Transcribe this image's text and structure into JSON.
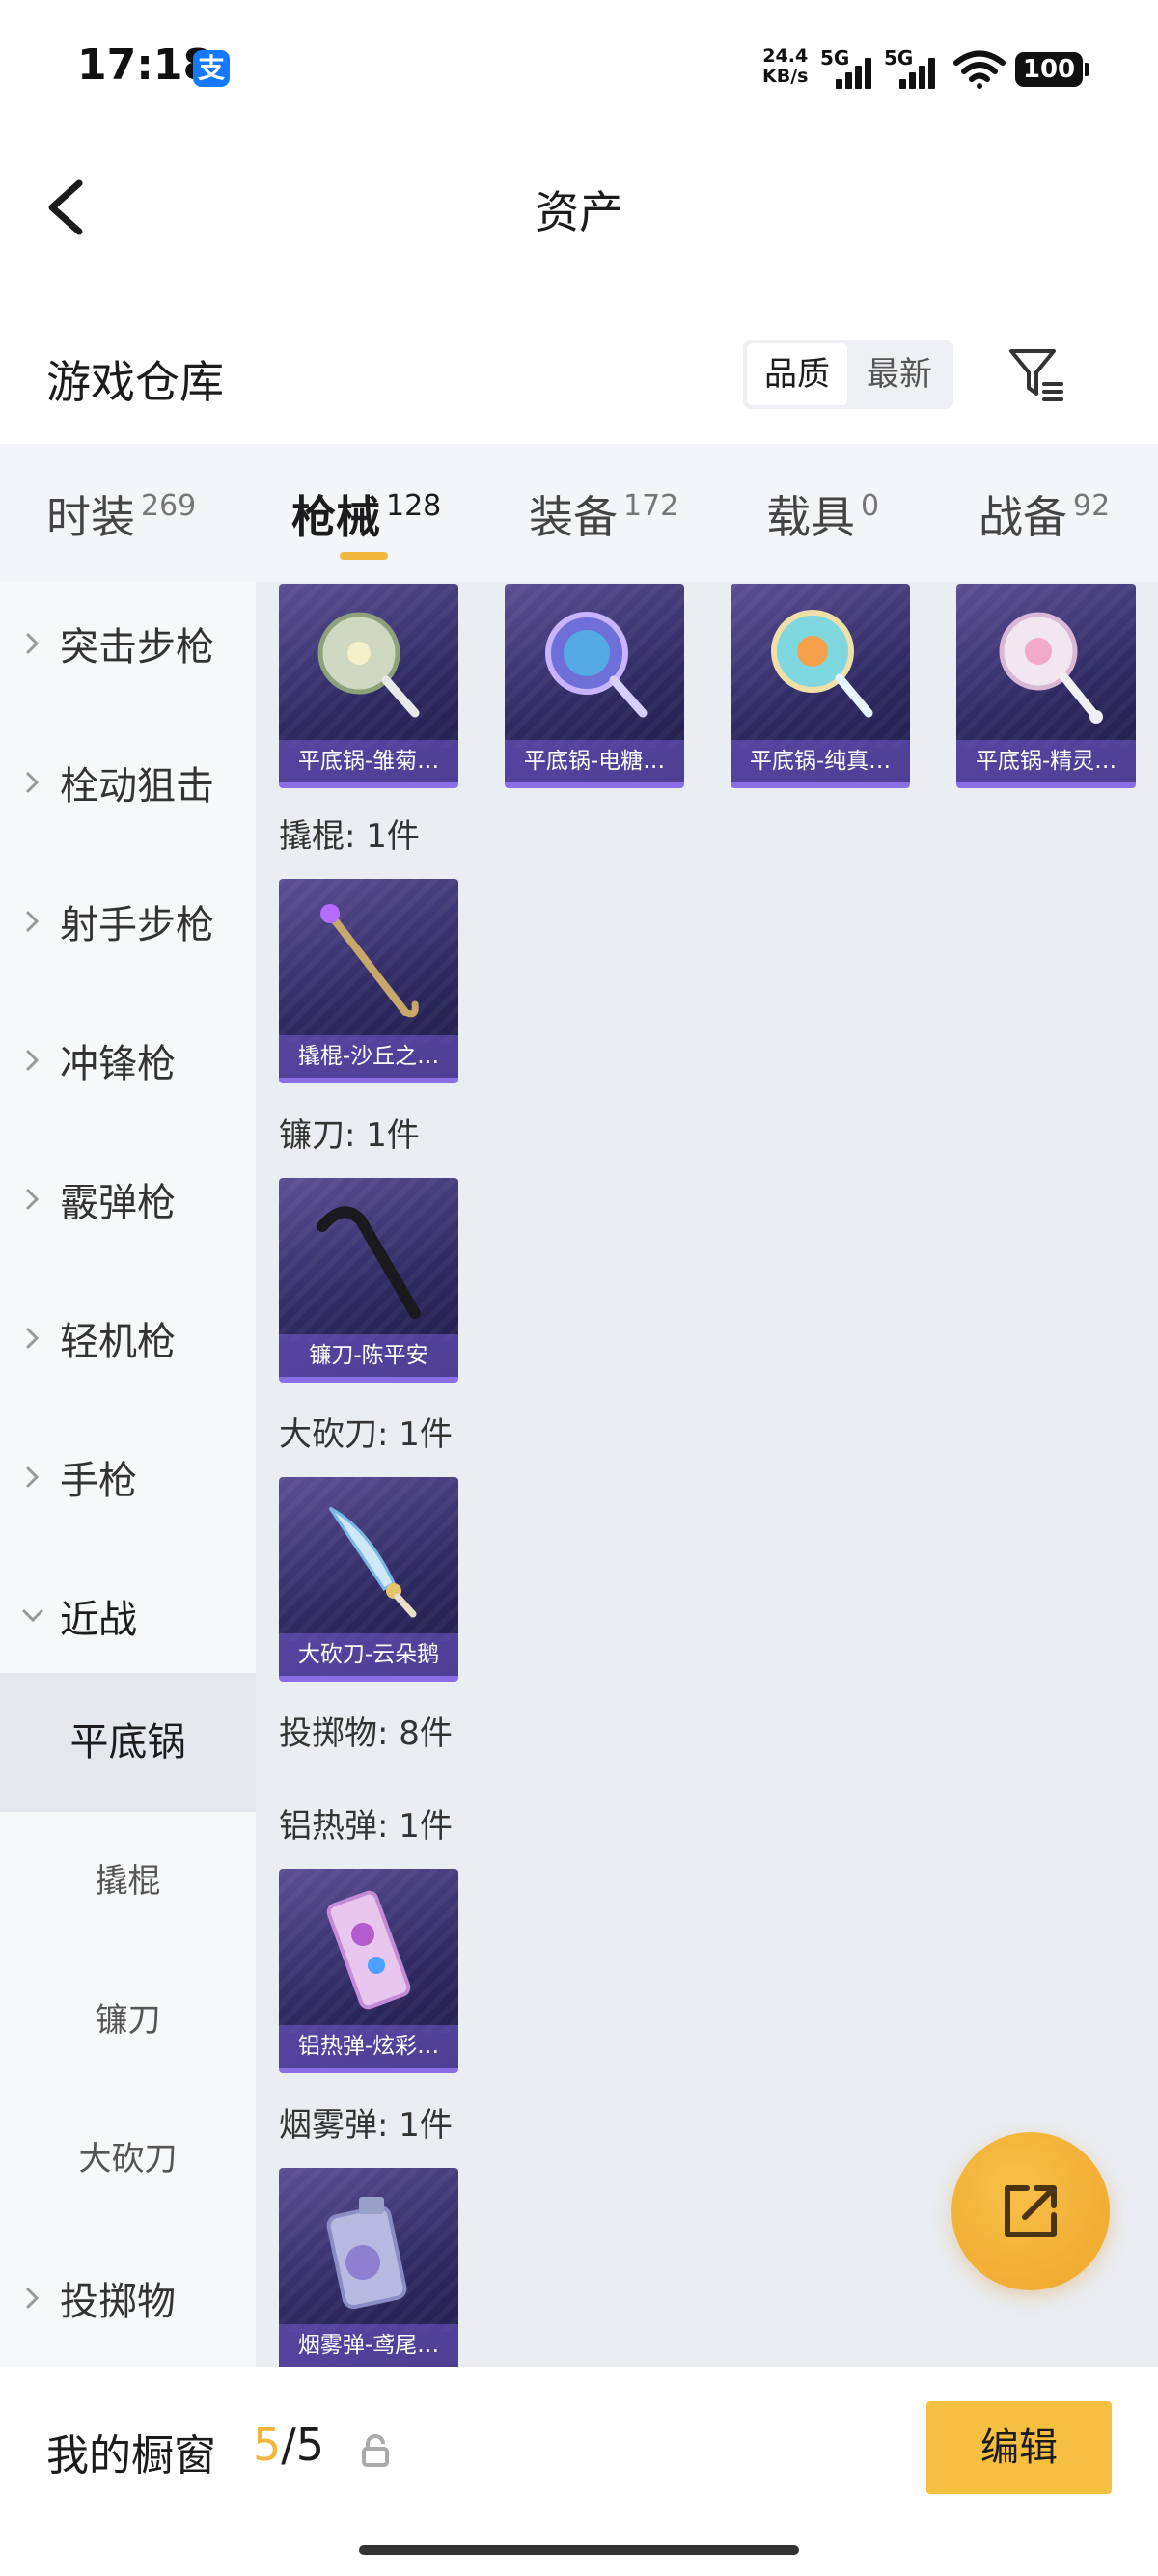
{
  "status_bar": {
    "time": "17:18",
    "app_badge_icon": "alipay-icon",
    "app_badge_glyph": "支",
    "net_speed_value": "24.4",
    "net_speed_unit": "KB/s",
    "signal_1": "5G",
    "signal_2": "5G",
    "wifi_icon": "wifi-icon",
    "battery": "100"
  },
  "nav": {
    "title": "资产",
    "back_icon": "chevron-left-icon"
  },
  "section": {
    "title": "游戏仓库",
    "sort_options": [
      "品质",
      "最新"
    ],
    "sort_selected": "品质",
    "filter_icon": "filter-icon"
  },
  "tabs": [
    {
      "name": "时装",
      "count": "269"
    },
    {
      "name": "枪械",
      "count": "128"
    },
    {
      "name": "装备",
      "count": "172"
    },
    {
      "name": "载具",
      "count": "0"
    },
    {
      "name": "战备",
      "count": "92"
    }
  ],
  "active_tab": "枪械",
  "accent_color": "#f3b63c",
  "sidebar": {
    "categories": [
      "突击步枪",
      "栓动狙击",
      "射手步枪",
      "冲锋枪",
      "霰弹枪",
      "轻机枪",
      "手枪",
      "近战"
    ],
    "expanded": "近战",
    "subcategories": [
      "平底锅",
      "撬棍",
      "镰刀",
      "大砍刀"
    ],
    "selected_sub": "平底锅",
    "after": [
      "投掷物"
    ]
  },
  "content": {
    "top_row": [
      {
        "caption": "平底锅-雏菊…",
        "icon": "daisy-pan-icon"
      },
      {
        "caption": "平底锅-电糖…",
        "icon": "candy-pan-icon"
      },
      {
        "caption": "平底锅-纯真…",
        "icon": "innocent-pan-icon"
      },
      {
        "caption": "平底锅-精灵…",
        "icon": "fairy-pan-icon"
      }
    ],
    "groups": [
      {
        "label": "撬棍: 1件",
        "items": [
          {
            "caption": "撬棍-沙丘之…",
            "icon": "crowbar-icon"
          }
        ]
      },
      {
        "label": "镰刀: 1件",
        "items": [
          {
            "caption": "镰刀-陈平安",
            "icon": "sickle-icon"
          }
        ]
      },
      {
        "label": "大砍刀: 1件",
        "items": [
          {
            "caption": "大砍刀-云朵鹅",
            "icon": "machete-icon"
          }
        ]
      },
      {
        "label": "投掷物: 8件",
        "items": []
      },
      {
        "label": "铝热弹: 1件",
        "items": [
          {
            "caption": "铝热弹-炫彩…",
            "icon": "thermite-grenade-icon"
          }
        ]
      },
      {
        "label": "烟雾弹: 1件",
        "items": [
          {
            "caption": "烟雾弹-鸢尾…",
            "icon": "smoke-grenade-icon"
          }
        ]
      }
    ]
  },
  "fab": {
    "icon": "share-external-icon"
  },
  "bottom_bar": {
    "label": "我的橱窗",
    "current": "5",
    "separator": "/",
    "total": "5",
    "lock_icon": "lock-icon",
    "edit_label": "编辑"
  }
}
